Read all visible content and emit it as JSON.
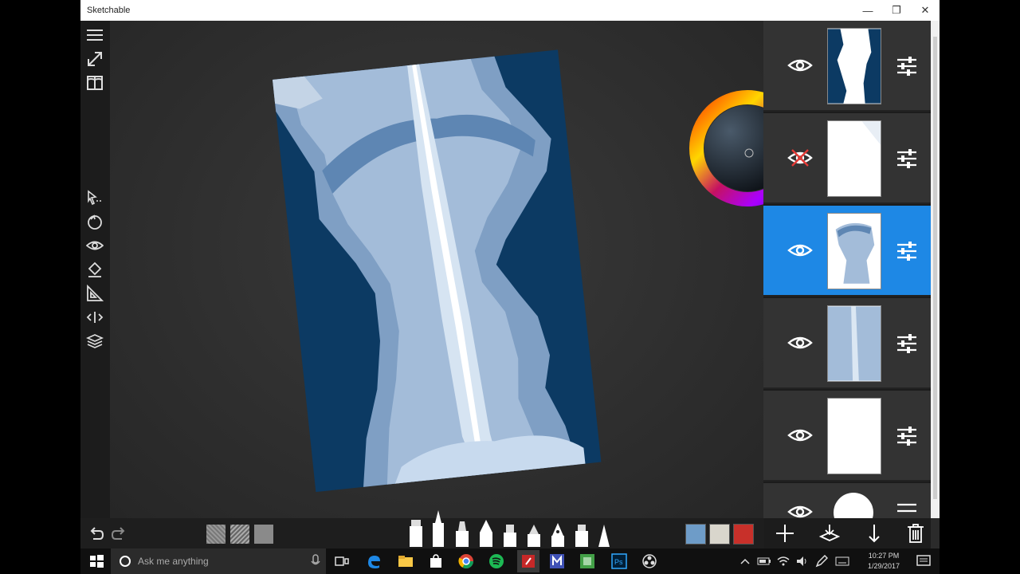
{
  "app": {
    "title": "Sketchable"
  },
  "window_controls": {
    "minimize": "—",
    "maximize": "❐",
    "close": "✕"
  },
  "left_tools": [
    "menu-icon",
    "fullscreen-icon",
    "book-icon",
    "selection-icon",
    "transform-icon",
    "visibility-icon",
    "fill-icon",
    "ruler-icon",
    "symmetry-icon",
    "layers-icon"
  ],
  "layers": [
    {
      "name": "layer-1",
      "visible": true,
      "selected": false
    },
    {
      "name": "layer-2",
      "visible": false,
      "selected": false
    },
    {
      "name": "layer-3",
      "visible": true,
      "selected": true
    },
    {
      "name": "layer-4",
      "visible": true,
      "selected": false
    },
    {
      "name": "layer-5",
      "visible": true,
      "selected": false
    }
  ],
  "palette": {
    "swatches": [
      "#6e9cc8",
      "#d9d6cc",
      "#c8302a"
    ]
  },
  "colors": {
    "accent": "#1e88e5",
    "canvas_dark": "#0a3a62",
    "canvas_light": "#a9c0d8"
  },
  "taskbar": {
    "search_placeholder": "Ask me anything",
    "time": "10:27 PM",
    "date": "1/29/2017"
  }
}
